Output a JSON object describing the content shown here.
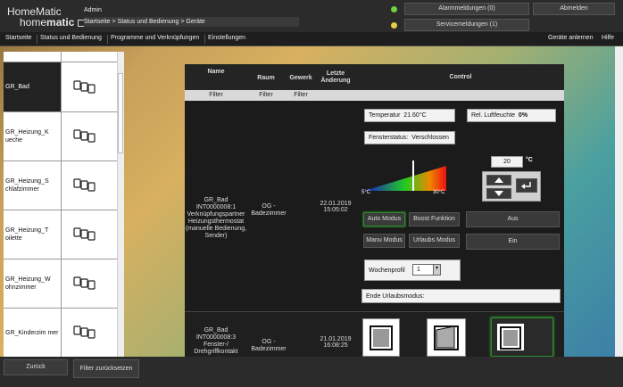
{
  "header": {
    "logo_line1": "HomeMatic",
    "logo_line2a": "home",
    "logo_line2b": "matic",
    "user": "Admin",
    "breadcrumb": "Startseite > Status und Bedienung > Geräte",
    "alarm_label": "Alarmmeldungen (0)",
    "service_label": "Servicemeldungen (1)",
    "logout_label": "Abmelden",
    "alarm_led_color": "#6fd040",
    "service_led_color": "#e8d040"
  },
  "menu": {
    "items": [
      "Startseite",
      "Status und Bedienung",
      "Programme und Verknüpfungen",
      "Einstellungen"
    ],
    "right": [
      "Geräte anlernen",
      "Hilfe"
    ]
  },
  "left_list": [
    {
      "name": "GR_Bad",
      "selected": true
    },
    {
      "name": "GR_Heizung_K ueche"
    },
    {
      "name": "GR_Heizung_S chlafzimmer"
    },
    {
      "name": "GR_Heizung_T oilette"
    },
    {
      "name": "GR_Heizung_W ohnzimmer"
    },
    {
      "name": "GR_Kinderzim mer"
    }
  ],
  "table": {
    "headers": {
      "name": "Name",
      "room": "Raum",
      "trade": "Gewerk",
      "last_change": "Letzte Änderung",
      "control": "Control"
    },
    "filter": "Filter",
    "rows": [
      {
        "name": "GR_Bad INT0000008:1 Verknüpfungspartner Heizungsthermostat (manuelle Bedienung, Sender)",
        "room": "OG - Badezimmer",
        "date": "22.01.2019",
        "time": "15:05:02"
      },
      {
        "name": "GR_Bad INT0000008:3 Fenster-/ Drehgriffkontakt",
        "room": "OG - Badezimmer",
        "date": "21.01.2019",
        "time": "16:08:25"
      }
    ]
  },
  "control": {
    "temperature_label": "Temperatur",
    "temperature_value": "21.60°C",
    "humidity_label": "Rel. Luftfeuchte",
    "humidity_value": "0%",
    "window_label": "Fensterstatus:",
    "window_value": "Verschlossen",
    "setpoint": "20",
    "setpoint_unit": "°C",
    "scale_min": "5°C",
    "scale_max": "30°C",
    "auto_mode": "Auto Modus",
    "boost": "Boost Funktion",
    "manual_mode": "Manu Modus",
    "holiday_mode": "Urlaubs Modus",
    "off": "Aus",
    "on": "Ein",
    "week_profile_label": "Wochenprofil",
    "week_profile_value": "1",
    "holiday_end_label": "Ende Urlaubsmodus:"
  },
  "bottom": {
    "back": "Zurück",
    "reset_filter": "Filter zurücksetzen"
  }
}
